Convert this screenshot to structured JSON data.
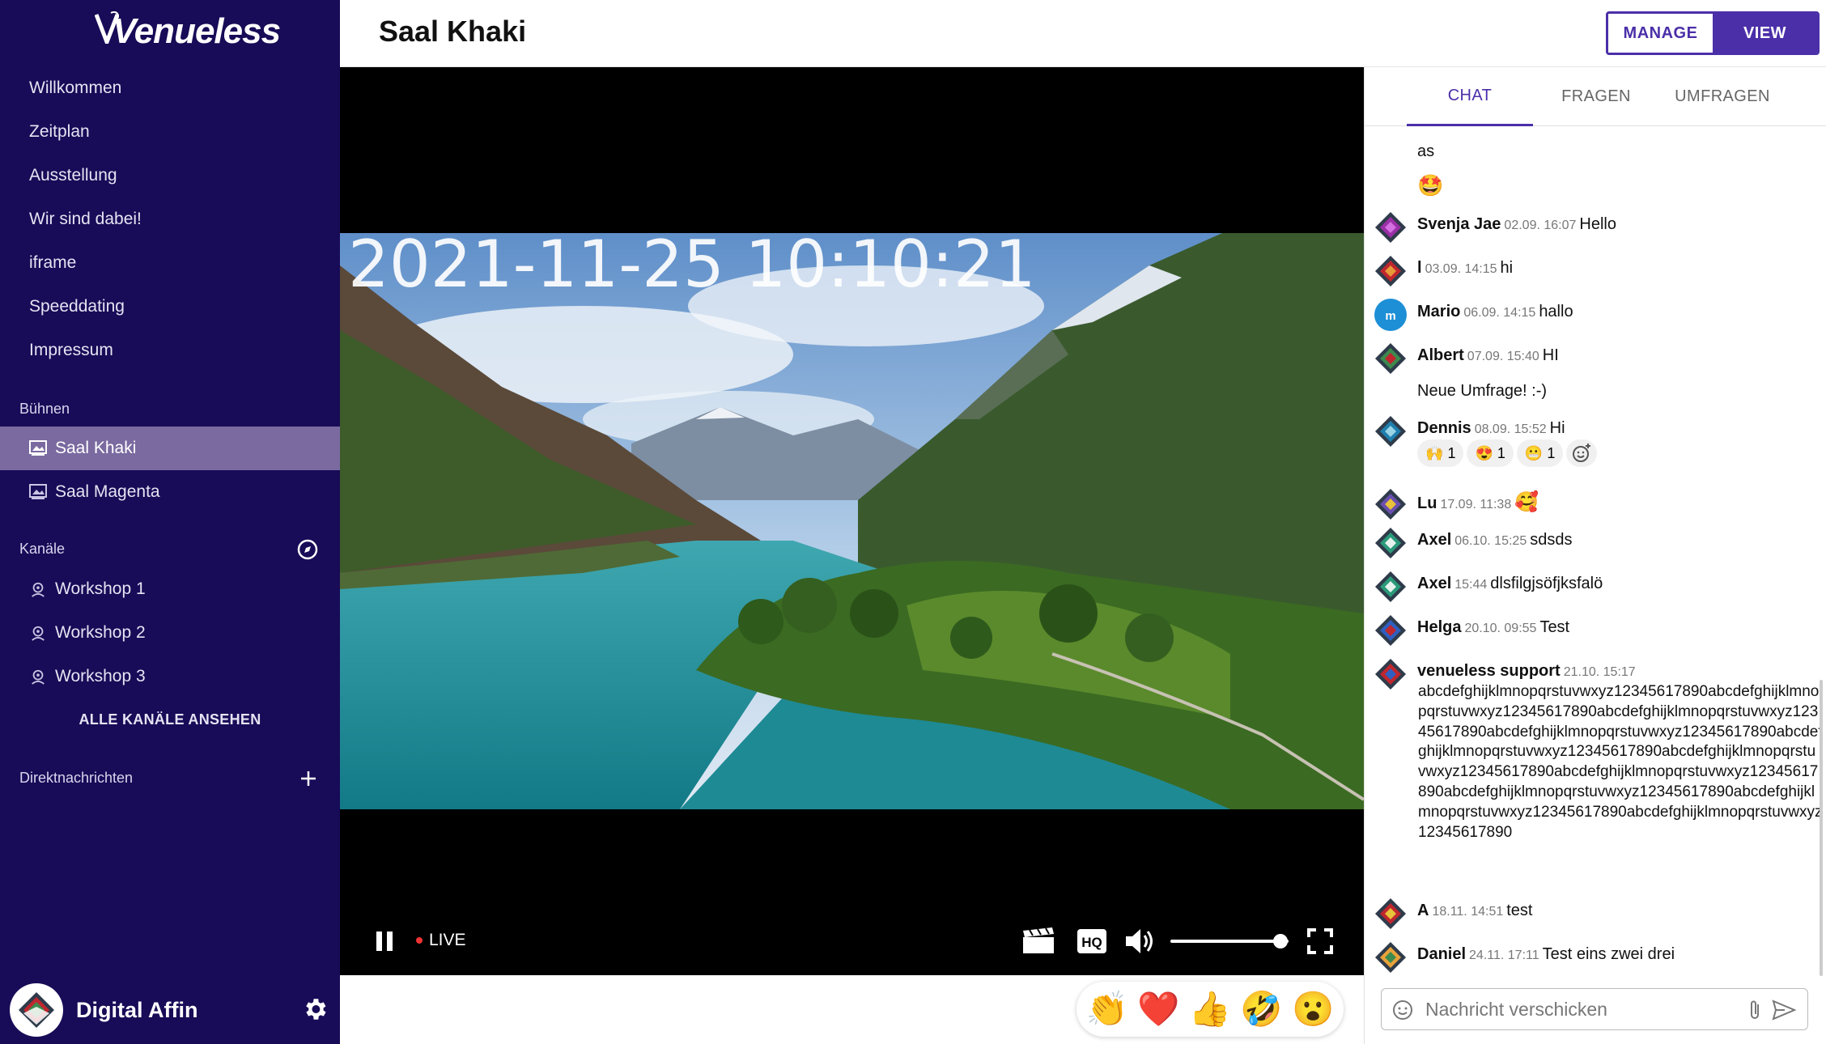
{
  "brand": {
    "logo_text": "Venueless"
  },
  "sidebar": {
    "nav": [
      "Willkommen",
      "Zeitplan",
      "Ausstellung",
      "Wir sind dabei!",
      "iframe",
      "Speeddating",
      "Impressum"
    ],
    "stages_title": "Bühnen",
    "stages": [
      "Saal Khaki",
      "Saal Magenta"
    ],
    "active_stage": "Saal Khaki",
    "channels_title": "Kanäle",
    "channels": [
      "Workshop 1",
      "Workshop 2",
      "Workshop 3"
    ],
    "see_all_channels": "ALLE KANÄLE ANSEHEN",
    "dm_title": "Direktnachrichten",
    "user_name": "Digital Affin"
  },
  "header": {
    "title": "Saal Khaki",
    "manage_label": "MANAGE",
    "view_label": "VIEW"
  },
  "video": {
    "timestamp": "2021-11-25 10:10:21",
    "live_label": "LIVE",
    "volume": 0.93
  },
  "reactions": [
    "👏",
    "❤️",
    "👍",
    "🤣",
    "😮"
  ],
  "chat": {
    "tabs": [
      "CHAT",
      "FRAGEN",
      "UMFRAGEN"
    ],
    "active_tab": "CHAT",
    "messages": [
      {
        "text": "as"
      },
      {
        "text": "🤩"
      },
      {
        "user": "Svenja Jae",
        "time": "02.09. 16:07",
        "text": "Hello"
      },
      {
        "user": "l",
        "time": "03.09. 14:15",
        "text": "hi"
      },
      {
        "user": "Mario",
        "time": "06.09. 14:15",
        "text": "hallo"
      },
      {
        "user": "Albert",
        "time": "07.09. 15:40",
        "text": "HI"
      },
      {
        "text": "Neue Umfrage! :-)"
      },
      {
        "user": "Dennis",
        "time": "08.09. 15:52",
        "text": "Hi"
      },
      {
        "user": "Lu",
        "time": "17.09. 11:38",
        "text": "🥰"
      },
      {
        "user": "Axel",
        "time": "06.10. 15:25",
        "text": "sdsds"
      },
      {
        "user": "Axel",
        "time": "15:44",
        "text": "dlsfilgjsöfjksfalö"
      },
      {
        "user": "Helga",
        "time": "20.10. 09:55",
        "text": "Test"
      },
      {
        "user": "venueless support",
        "time": "21.10. 15:17",
        "text": "abcdefghijklmnopqrstuvwxyz12345617890abcdefghijklmnopqrstuvwxyz12345617890abcdefghijklmnopqrstuvwxyz12345617890abcdefghijklmnopqrstuvwxyz12345617890abcdefghijklmnopqrstuvwxyz12345617890abcdefghijklmnopqrstuvwxyz12345617890abcdefghijklmnopqrstuvwxyz12345617890abcdefghijklmnopqrstuvwxyz12345617890abcdefghijklmnopqrstuvwxyz12345617890abcdefghijklmnopqrstuvwxyz12345617890"
      },
      {
        "user": "A",
        "time": "18.11. 14:51",
        "text": "test"
      },
      {
        "user": "Daniel",
        "time": "24.11. 17:11",
        "text": "Test eins zwei drei"
      }
    ],
    "dennis_reactions": [
      {
        "emoji": "🙌",
        "count": "1"
      },
      {
        "emoji": "😍",
        "count": "1"
      },
      {
        "emoji": "😬",
        "count": "1"
      }
    ],
    "input_placeholder": "Nachricht verschicken"
  },
  "colors": {
    "sidebar_bg": "#180b57",
    "accent": "#4b2fa8",
    "active_item": "#7a6aa0"
  }
}
